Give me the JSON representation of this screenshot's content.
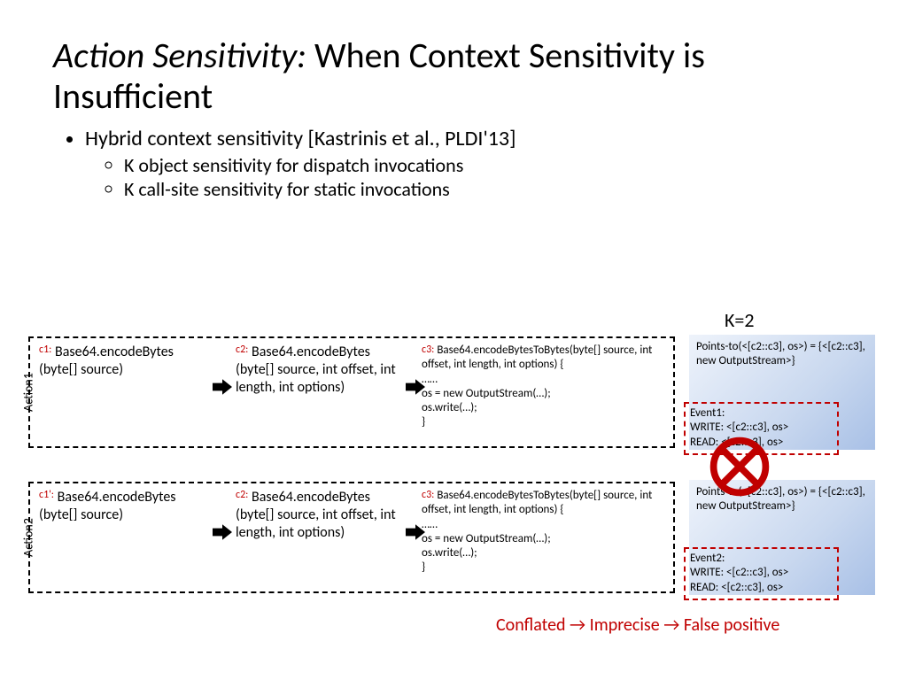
{
  "title": {
    "ital": "Action Sensitivity:",
    "rest": " When Context Sensitivity is Insufficient"
  },
  "bullets": {
    "top": "Hybrid context sensitivity [Kastrinis et al., PLDI'13]",
    "sub1": "K object sensitivity for dispatch invocations",
    "sub2": "K call-site sensitivity for static invocations"
  },
  "klabel": "K=2",
  "actions": {
    "a1": {
      "label": "Action1",
      "c1tag": "c1:",
      "c1": "Base64.encodeBytes (byte[] source)",
      "c2tag": "c2:",
      "c2": "Base64.encodeBytes (byte[] source, int offset, int length, int options)",
      "c3tag": "c3:",
      "c3head": "Base64.encodeBytesToBytes(byte[] source, int offset, int length, int options) {",
      "c3body": "……\nos = new OutputStream(…);\nos.write(…);\n}"
    },
    "a2": {
      "label": "Action2",
      "c1tag": "c1':",
      "c1": "Base64.encodeBytes (byte[] source)",
      "c2tag": "c2:",
      "c2": "Base64.encodeBytes (byte[] source, int offset, int length, int options)",
      "c3tag": "c3:",
      "c3head": "Base64.encodeBytesToBytes(byte[] source, int offset, int length, int options) {",
      "c3body": "……\nos = new OutputStream(…);\nos.write(…);\n}"
    }
  },
  "results": {
    "r1": {
      "points": "Points-to(<[c2::c3], os>) = {<[c2::c3], new OutputStream>}",
      "evtitle": "Event1:",
      "evwrite": "WRITE: <[c2::c3], os>",
      "evread": "READ: <[c2::c3], os>"
    },
    "r2": {
      "points": "Points-to(<[c2::c3], os>) = {<[c2::c3], new OutputStream>}",
      "evtitle": "Event2:",
      "evwrite": "WRITE: <[c2::c3], os>",
      "evread": "READ: <[c2::c3], os>"
    }
  },
  "footnote": "Conflated → Imprecise → False positive"
}
